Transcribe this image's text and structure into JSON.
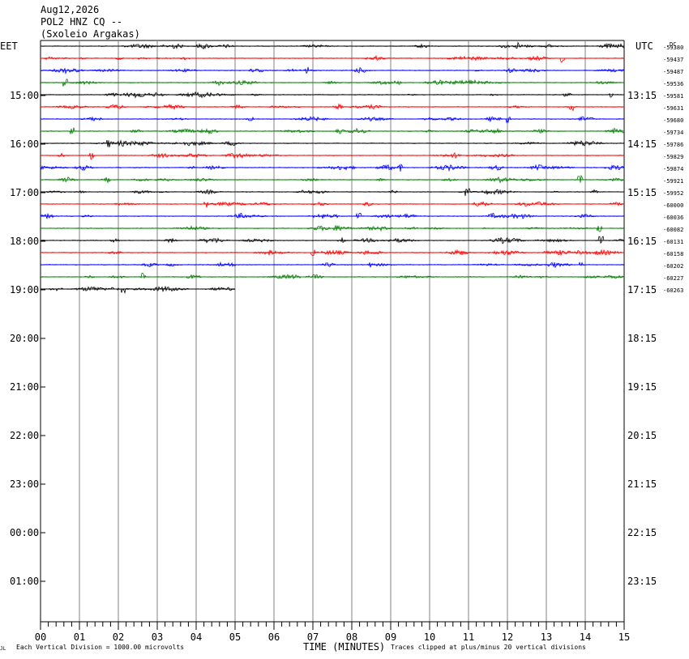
{
  "header": {
    "date": "Aug12,2026",
    "station": "POL2 HNZ CQ --",
    "site": "(Sxoleio Argakas)"
  },
  "left_axis_label": "EET",
  "right_axis_label": "UTC",
  "corner_label": "DC",
  "footer": {
    "vertical_division": "Each Vertical Division = 1000.00 microvolts",
    "xlabel": "TIME (MINUTES)",
    "clip_note": "Traces clipped at plus/minus 20 vertical divisions",
    "mark": "JL"
  },
  "colors": {
    "trace_cycle": [
      "#000000",
      "#ff0000",
      "#0000ff",
      "#008000"
    ],
    "grid": "#808080",
    "axis": "#000000"
  },
  "chart_data": {
    "type": "line",
    "x_ticks": [
      "00",
      "01",
      "02",
      "03",
      "04",
      "05",
      "06",
      "07",
      "08",
      "09",
      "10",
      "11",
      "12",
      "13",
      "14",
      "15"
    ],
    "xlim": [
      0,
      15
    ],
    "left_time_labels": [
      "15:00",
      "16:00",
      "17:00",
      "18:00",
      "19:00",
      "20:00",
      "21:00",
      "22:00",
      "23:00",
      "00:00",
      "01:00"
    ],
    "right_time_labels": [
      "13:15",
      "14:15",
      "15:15",
      "16:15",
      "17:15",
      "18:15",
      "19:15",
      "20:15",
      "21:15",
      "22:15",
      "23:15"
    ],
    "trace_offsets": [
      "-59380",
      "-59437",
      "-59487",
      "-59536",
      "-59581",
      "-59631",
      "-59680",
      "-59734",
      "-59786",
      "-59829",
      "-59874",
      "-59921",
      "-59952",
      "-60000",
      "-60036",
      "-60082",
      "-60131",
      "-60158",
      "-60202",
      "-60227",
      "-60263"
    ],
    "last_trace_end_minute": 5
  }
}
